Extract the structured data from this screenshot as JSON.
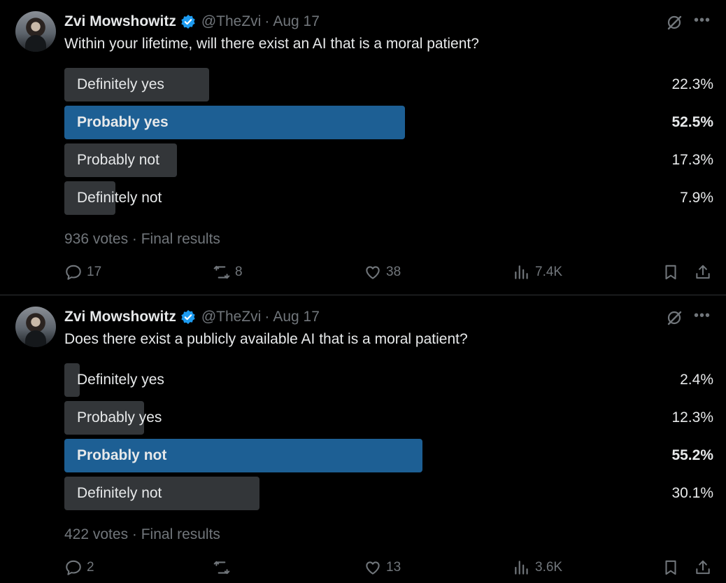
{
  "tweets": [
    {
      "author": "Zvi Mowshowitz",
      "handle": "@TheZvi",
      "separator": "·",
      "date": "Aug 17",
      "question": "Within your lifetime, will there exist an AI that is a moral patient?",
      "options": [
        {
          "label": "Definitely yes",
          "percent": "22.3%",
          "value": 22.3,
          "winner": false
        },
        {
          "label": "Probably yes",
          "percent": "52.5%",
          "value": 52.5,
          "winner": true
        },
        {
          "label": "Probably not",
          "percent": "17.3%",
          "value": 17.3,
          "winner": false
        },
        {
          "label": "Definitely not",
          "percent": "7.9%",
          "value": 7.9,
          "winner": false
        }
      ],
      "votes_text": "936 votes · Final results",
      "replies": "17",
      "retweets": "8",
      "likes": "38",
      "views": "7.4K"
    },
    {
      "author": "Zvi Mowshowitz",
      "handle": "@TheZvi",
      "separator": "·",
      "date": "Aug 17",
      "question": "Does there exist a publicly available AI that is a moral patient?",
      "options": [
        {
          "label": "Definitely yes",
          "percent": "2.4%",
          "value": 2.4,
          "winner": false
        },
        {
          "label": "Probably yes",
          "percent": "12.3%",
          "value": 12.3,
          "winner": false
        },
        {
          "label": "Probably not",
          "percent": "55.2%",
          "value": 55.2,
          "winner": true
        },
        {
          "label": "Definitely not",
          "percent": "30.1%",
          "value": 30.1,
          "winner": false
        }
      ],
      "votes_text": "422 votes · Final results",
      "replies": "2",
      "retweets": "",
      "likes": "13",
      "views": "3.6K"
    }
  ],
  "icons": {
    "verified": "verified-badge-icon",
    "grok": "grok-icon",
    "more": "more-icon",
    "reply": "reply-icon",
    "retweet": "retweet-icon",
    "like": "heart-icon",
    "views": "views-icon",
    "bookmark": "bookmark-icon",
    "share": "share-icon"
  },
  "colors": {
    "background": "#000000",
    "text": "#e7e9ea",
    "muted": "#71767b",
    "bar": "#333639",
    "winner_bar": "#1d5f94",
    "verified": "#1d9bf0"
  }
}
